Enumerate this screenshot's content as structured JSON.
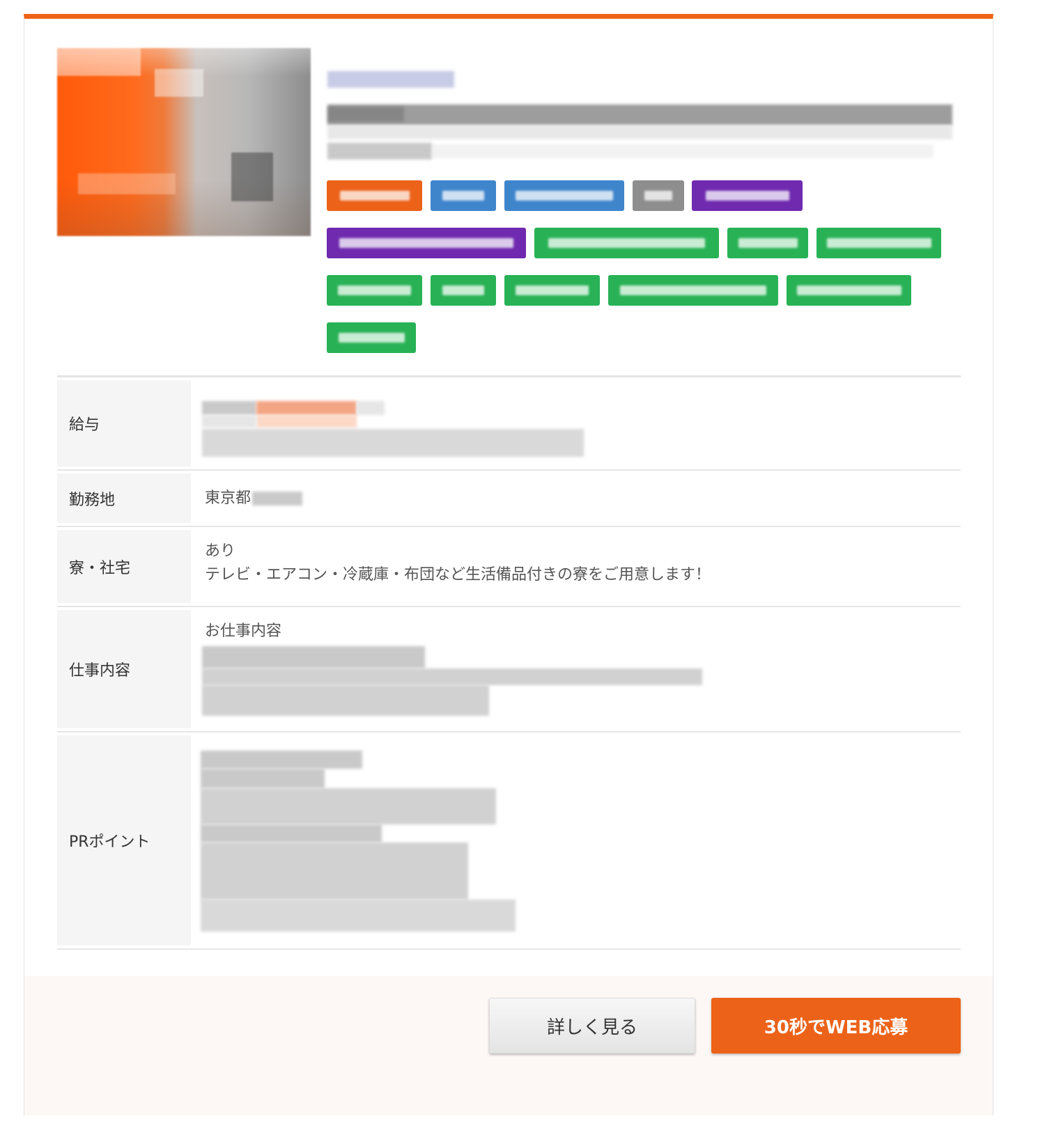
{
  "colors": {
    "accent": "#ee6316",
    "tag_orange": "#ec6219",
    "tag_blue": "#3f85cc",
    "tag_gray": "#8e8e8e",
    "tag_purple": "#6f2ab0",
    "tag_green": "#28b255"
  },
  "table": {
    "salary_label": "給与",
    "location_label": "勤務地",
    "location_value": "東京都",
    "dorm_label": "寮・社宅",
    "dorm_value_line1": "あり",
    "dorm_value_line2": "テレビ・エアコン・冷蔵庫・布団など生活備品付きの寮をご用意します！",
    "job_label": "仕事内容",
    "job_value_heading": "お仕事内容",
    "pr_label": "PRポイント"
  },
  "actions": {
    "detail_label": "詳しく見る",
    "apply_label": "30秒でWEB応募"
  }
}
